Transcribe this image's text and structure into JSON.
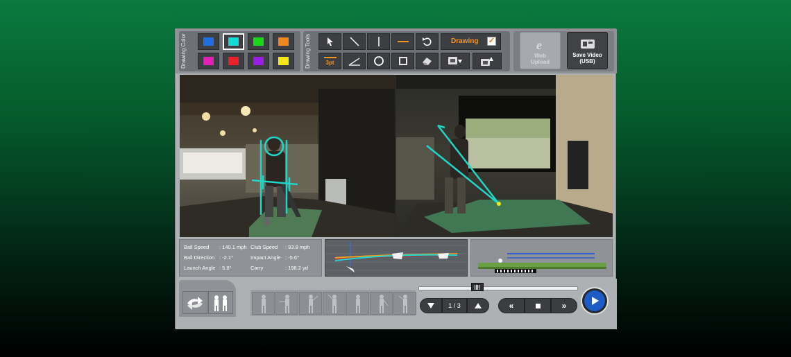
{
  "toolbar": {
    "color_section_label": "Drawing Color",
    "colors": [
      "#1f6fe0",
      "#16d8d8",
      "#18d818",
      "#ef8620",
      "#e21fb8",
      "#e8202a",
      "#9a1ee8",
      "#f4e818"
    ],
    "selected_color": "#16d8d8",
    "tools_section_label": "Drawing Tools",
    "tools_row1": [
      "pointer-icon",
      "diagonal-line-icon",
      "vertical-line-icon",
      "horizontal-line-icon",
      "undo-icon"
    ],
    "tools_row2": [
      "line-width-icon",
      "angle-icon",
      "circle-icon",
      "square-icon",
      "eraser-icon",
      "save-drawing-icon",
      "export-drawing-icon"
    ],
    "line_width_label": "3pt",
    "drawing_label": "Drawing",
    "drawing_checked": true,
    "web_upload_label_1": "Web",
    "web_upload_label_2": "Upload",
    "save_video_label_1": "Save Video",
    "save_video_label_2": "(USB)"
  },
  "stats": {
    "ball_speed_label": "Ball Speed",
    "ball_speed_value": ": 140.1 mph",
    "ball_direction_label": "Ball Direction",
    "ball_direction_value": ": -2.1°",
    "launch_angle_label": "Launch Angle",
    "launch_angle_value": ": 5.8°",
    "club_speed_label": "Club Speed",
    "club_speed_value": ": 93.8 mph",
    "impact_angle_label": "Impact Angle",
    "impact_angle_value": ": -5.6°",
    "carry_label": "Carry",
    "carry_value": ": 198.2 yd"
  },
  "playback": {
    "page_indicator": "1 / 3",
    "scrub_position": 0.36,
    "swing_frames": 7
  },
  "accent_colors": {
    "drawing_line": "#1fd6c8",
    "orange_text": "#f7941d",
    "play_button": "#1c5cc4"
  }
}
